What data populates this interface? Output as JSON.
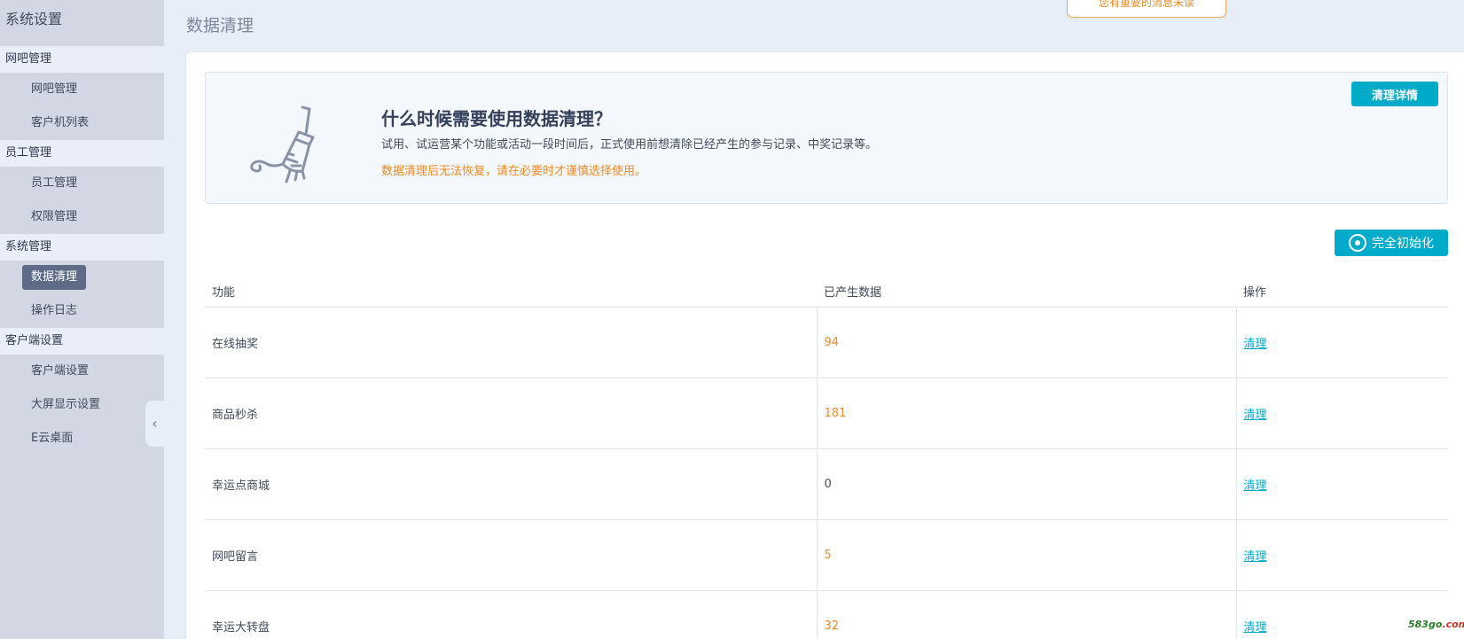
{
  "sidebar": {
    "title": "系统设置",
    "groups": [
      {
        "label": "网吧管理",
        "items": [
          "网吧管理",
          "客户机列表"
        ]
      },
      {
        "label": "员工管理",
        "items": [
          "员工管理",
          "权限管理"
        ]
      },
      {
        "label": "系统管理",
        "items": [
          "数据清理",
          "操作日志"
        ]
      },
      {
        "label": "客户端设置",
        "items": [
          "客户端设置",
          "大屏显示设置",
          "E云桌面"
        ]
      }
    ],
    "active_item": "数据清理"
  },
  "header": {
    "page_title": "数据清理",
    "toast": "您有重要的消息未读"
  },
  "info": {
    "title": "什么时候需要使用数据清理？",
    "desc": "试用、试运营某个功能或活动一段时间后，正式使用前想清除已经产生的参与记录、中奖记录等。",
    "warning": "数据清理后无法恢复，请在必要时才谨慎选择使用。",
    "detail_button": "清理详情"
  },
  "actions": {
    "init_button": "完全初始化"
  },
  "table": {
    "headers": [
      "功能",
      "已产生数据",
      "操作"
    ],
    "rows": [
      {
        "name": "在线抽奖",
        "count": "94",
        "action": "清理"
      },
      {
        "name": "商品秒杀",
        "count": "181",
        "action": "清理"
      },
      {
        "name": "幸运点商城",
        "count": "0",
        "action": "清理"
      },
      {
        "name": "网吧留言",
        "count": "5",
        "action": "清理"
      },
      {
        "name": "幸运大转盘",
        "count": "32",
        "action": "清理"
      }
    ]
  },
  "watermark": {
    "prefix": "583go",
    "suffix": ".com"
  },
  "colors": {
    "accent": "#00abc9",
    "warning": "#f08a24",
    "sidebar_bg": "#d3d7e3"
  }
}
